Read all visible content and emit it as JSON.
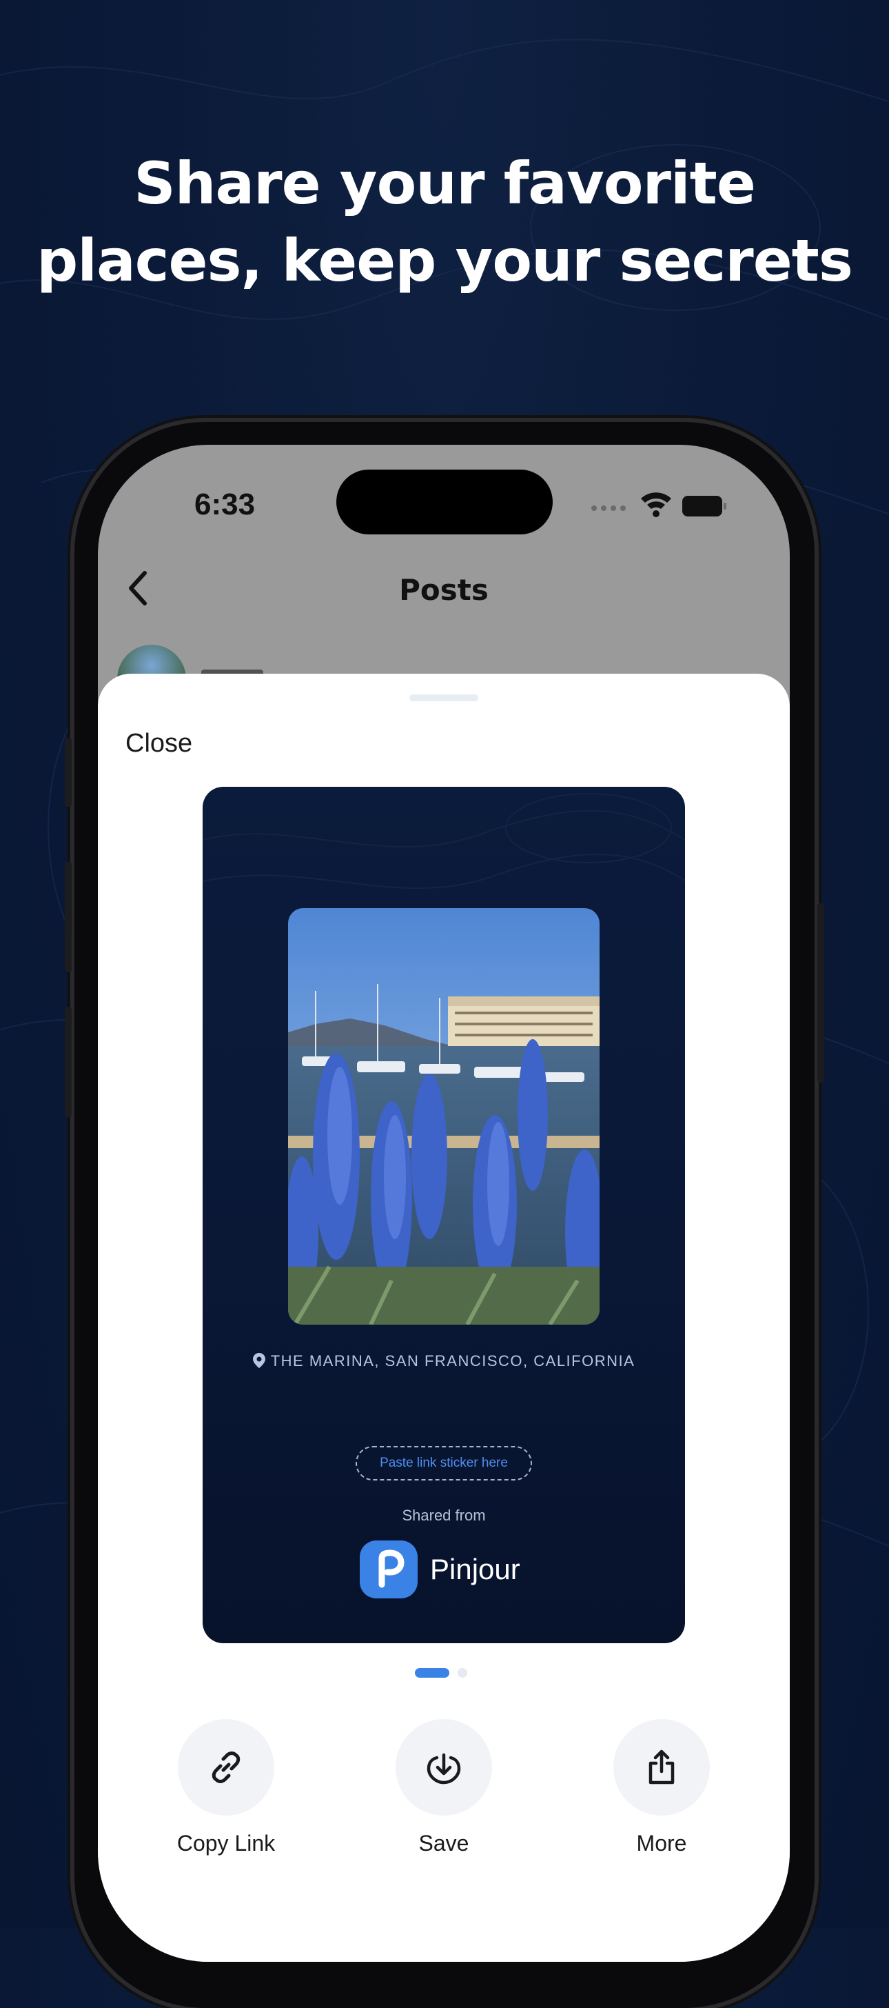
{
  "headline": {
    "line1": "Share your favorite",
    "line2": "places, keep your secrets"
  },
  "status_bar": {
    "time": "6:33",
    "icons": [
      "cellular-signal-icon",
      "wifi-icon",
      "battery-icon"
    ]
  },
  "nav": {
    "back_icon": "chevron-left-icon",
    "title": "Posts"
  },
  "sheet": {
    "close_label": "Close",
    "card": {
      "location": "THE MARINA, SAN FRANCISCO, CALIFORNIA",
      "sticker_placeholder": "Paste link sticker here",
      "shared_from": "Shared from",
      "brand_name": "Pinjour"
    },
    "pager": {
      "count": 2,
      "active": 1
    },
    "actions": [
      {
        "label": "Copy Link",
        "icon": "link-icon"
      },
      {
        "label": "Save",
        "icon": "download-icon"
      },
      {
        "label": "More",
        "icon": "share-icon"
      }
    ]
  },
  "colors": {
    "background": "#0b1a38",
    "accent": "#3b82e6",
    "sheet": "#ffffff",
    "dimmed_overlay": "#9a9a9a"
  }
}
